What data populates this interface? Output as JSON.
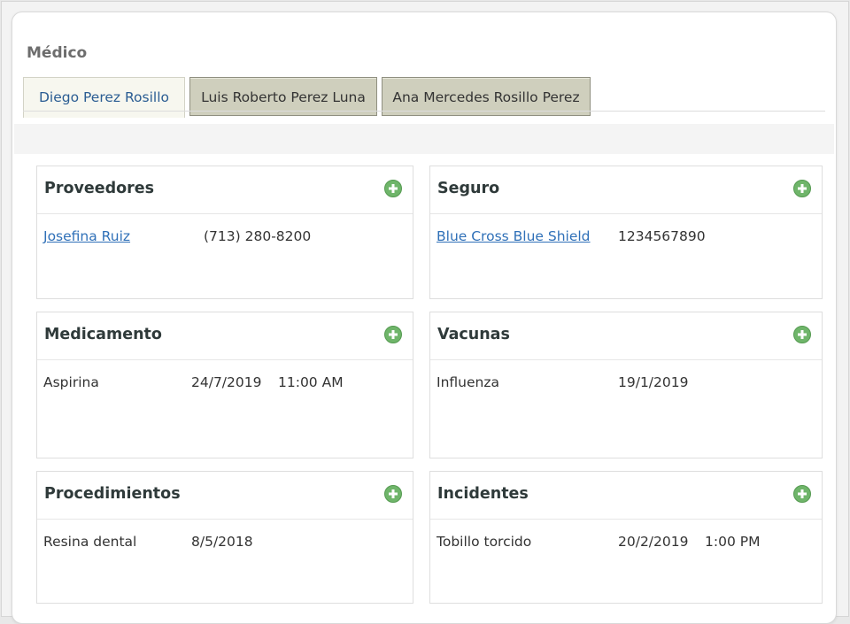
{
  "section_title": "Médico",
  "tabs": [
    {
      "label": "Diego Perez Rosillo",
      "active": true
    },
    {
      "label": "Luis Roberto Perez Luna",
      "active": false
    },
    {
      "label": "Ana Mercedes Rosillo Perez",
      "active": false
    }
  ],
  "icons": {
    "add": "plus-circle-icon"
  },
  "colors": {
    "tab_active_text": "#2b5d93",
    "tab_inactive_bg": "#cfcfbd",
    "link": "#2f70b8",
    "add_icon": "#6fb56a"
  },
  "panels": {
    "providers": {
      "title": "Proveedores",
      "name": "Josefina Ruiz",
      "phone": "(713) 280-8200"
    },
    "insurance": {
      "title": "Seguro",
      "name": "Blue Cross Blue Shield",
      "number": "1234567890"
    },
    "medication": {
      "title": "Medicamento",
      "name": "Aspirina",
      "date": "24/7/2019",
      "time": "11:00 AM"
    },
    "vaccines": {
      "title": "Vacunas",
      "name": "Influenza",
      "date": "19/1/2019"
    },
    "procedures": {
      "title": "Procedimientos",
      "name": "Resina dental",
      "date": "8/5/2018"
    },
    "incidents": {
      "title": "Incidentes",
      "name": "Tobillo torcido",
      "date": "20/2/2019",
      "time": "1:00 PM"
    }
  }
}
